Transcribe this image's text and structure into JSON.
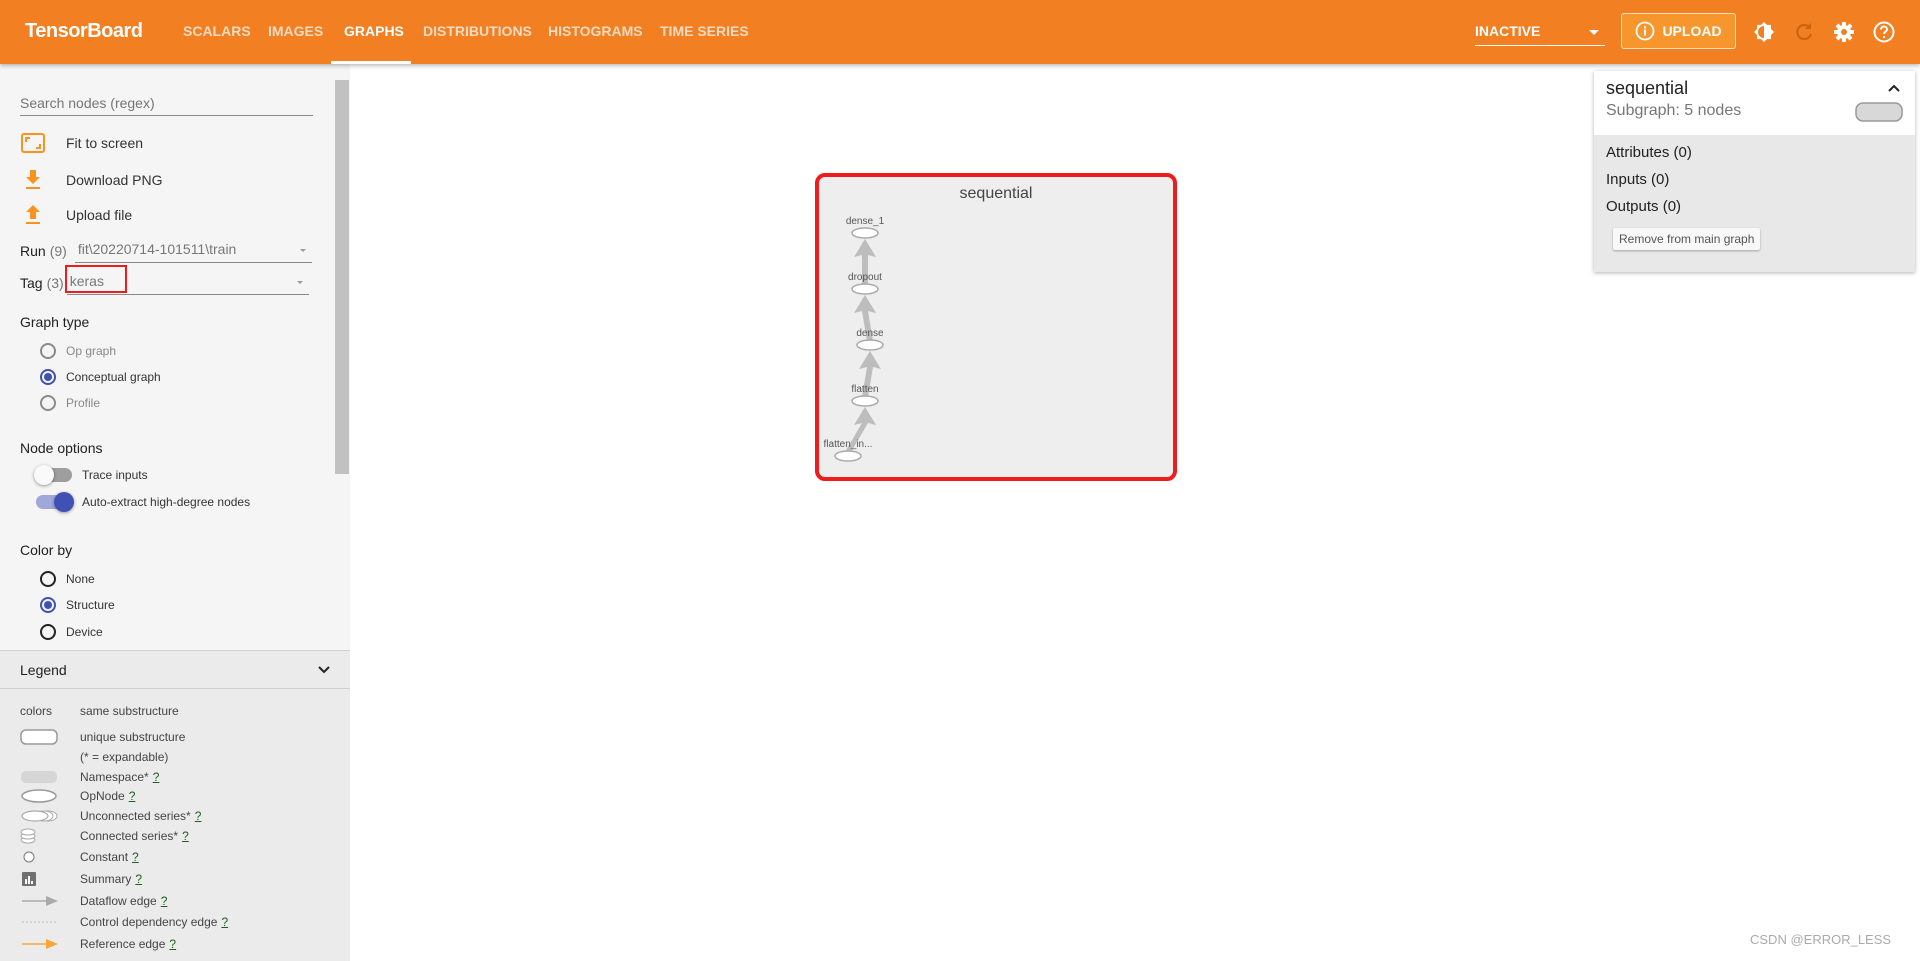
{
  "header": {
    "logo": "TensorBoard",
    "tabs": [
      "SCALARS",
      "IMAGES",
      "GRAPHS",
      "DISTRIBUTIONS",
      "HISTOGRAMS",
      "TIME SERIES"
    ],
    "active_tab": "GRAPHS",
    "status_select": "INACTIVE",
    "upload_label": "UPLOAD",
    "icons": [
      "theme-icon",
      "reload-icon",
      "settings-icon",
      "help-icon"
    ],
    "brand_color": "#f27f22"
  },
  "sidebar": {
    "search_placeholder": "Search nodes (regex)",
    "actions": [
      "Fit to screen",
      "Download PNG",
      "Upload file"
    ],
    "run": {
      "label": "Run",
      "count": "(9)",
      "value": "fit\\20220714-101511\\train"
    },
    "tag": {
      "label": "Tag",
      "count": "(3)",
      "value": "keras"
    },
    "graph_type": {
      "title": "Graph type",
      "options": [
        "Op graph",
        "Conceptual graph",
        "Profile"
      ],
      "selected": "Conceptual graph"
    },
    "node_options": {
      "title": "Node options",
      "toggles": [
        {
          "label": "Trace inputs",
          "on": false
        },
        {
          "label": "Auto-extract high-degree nodes",
          "on": true
        }
      ]
    },
    "color_by": {
      "title": "Color by",
      "options": [
        "None",
        "Structure",
        "Device"
      ],
      "selected": "Structure"
    },
    "legend": {
      "title": "Legend",
      "colors_label": "colors",
      "same_substructure": "same substructure",
      "unique_substructure": "unique substructure",
      "expandable": "(* = expandable)",
      "items": [
        "Namespace*",
        "OpNode",
        "Unconnected series*",
        "Connected series*",
        "Constant",
        "Summary",
        "Dataflow edge",
        "Control dependency edge",
        "Reference edge"
      ],
      "help": "?"
    }
  },
  "graph": {
    "title": "sequential",
    "nodes": [
      "dense_1",
      "dropout",
      "dense",
      "flatten",
      "flatten_in..."
    ]
  },
  "info_card": {
    "title": "sequential",
    "subtitle": "Subgraph: 5 nodes",
    "rows": [
      "Attributes (0)",
      "Inputs (0)",
      "Outputs (0)"
    ],
    "remove_button": "Remove from main graph"
  },
  "watermark": "CSDN @ERROR_LESS",
  "highlight_color": "#ee1c1c"
}
